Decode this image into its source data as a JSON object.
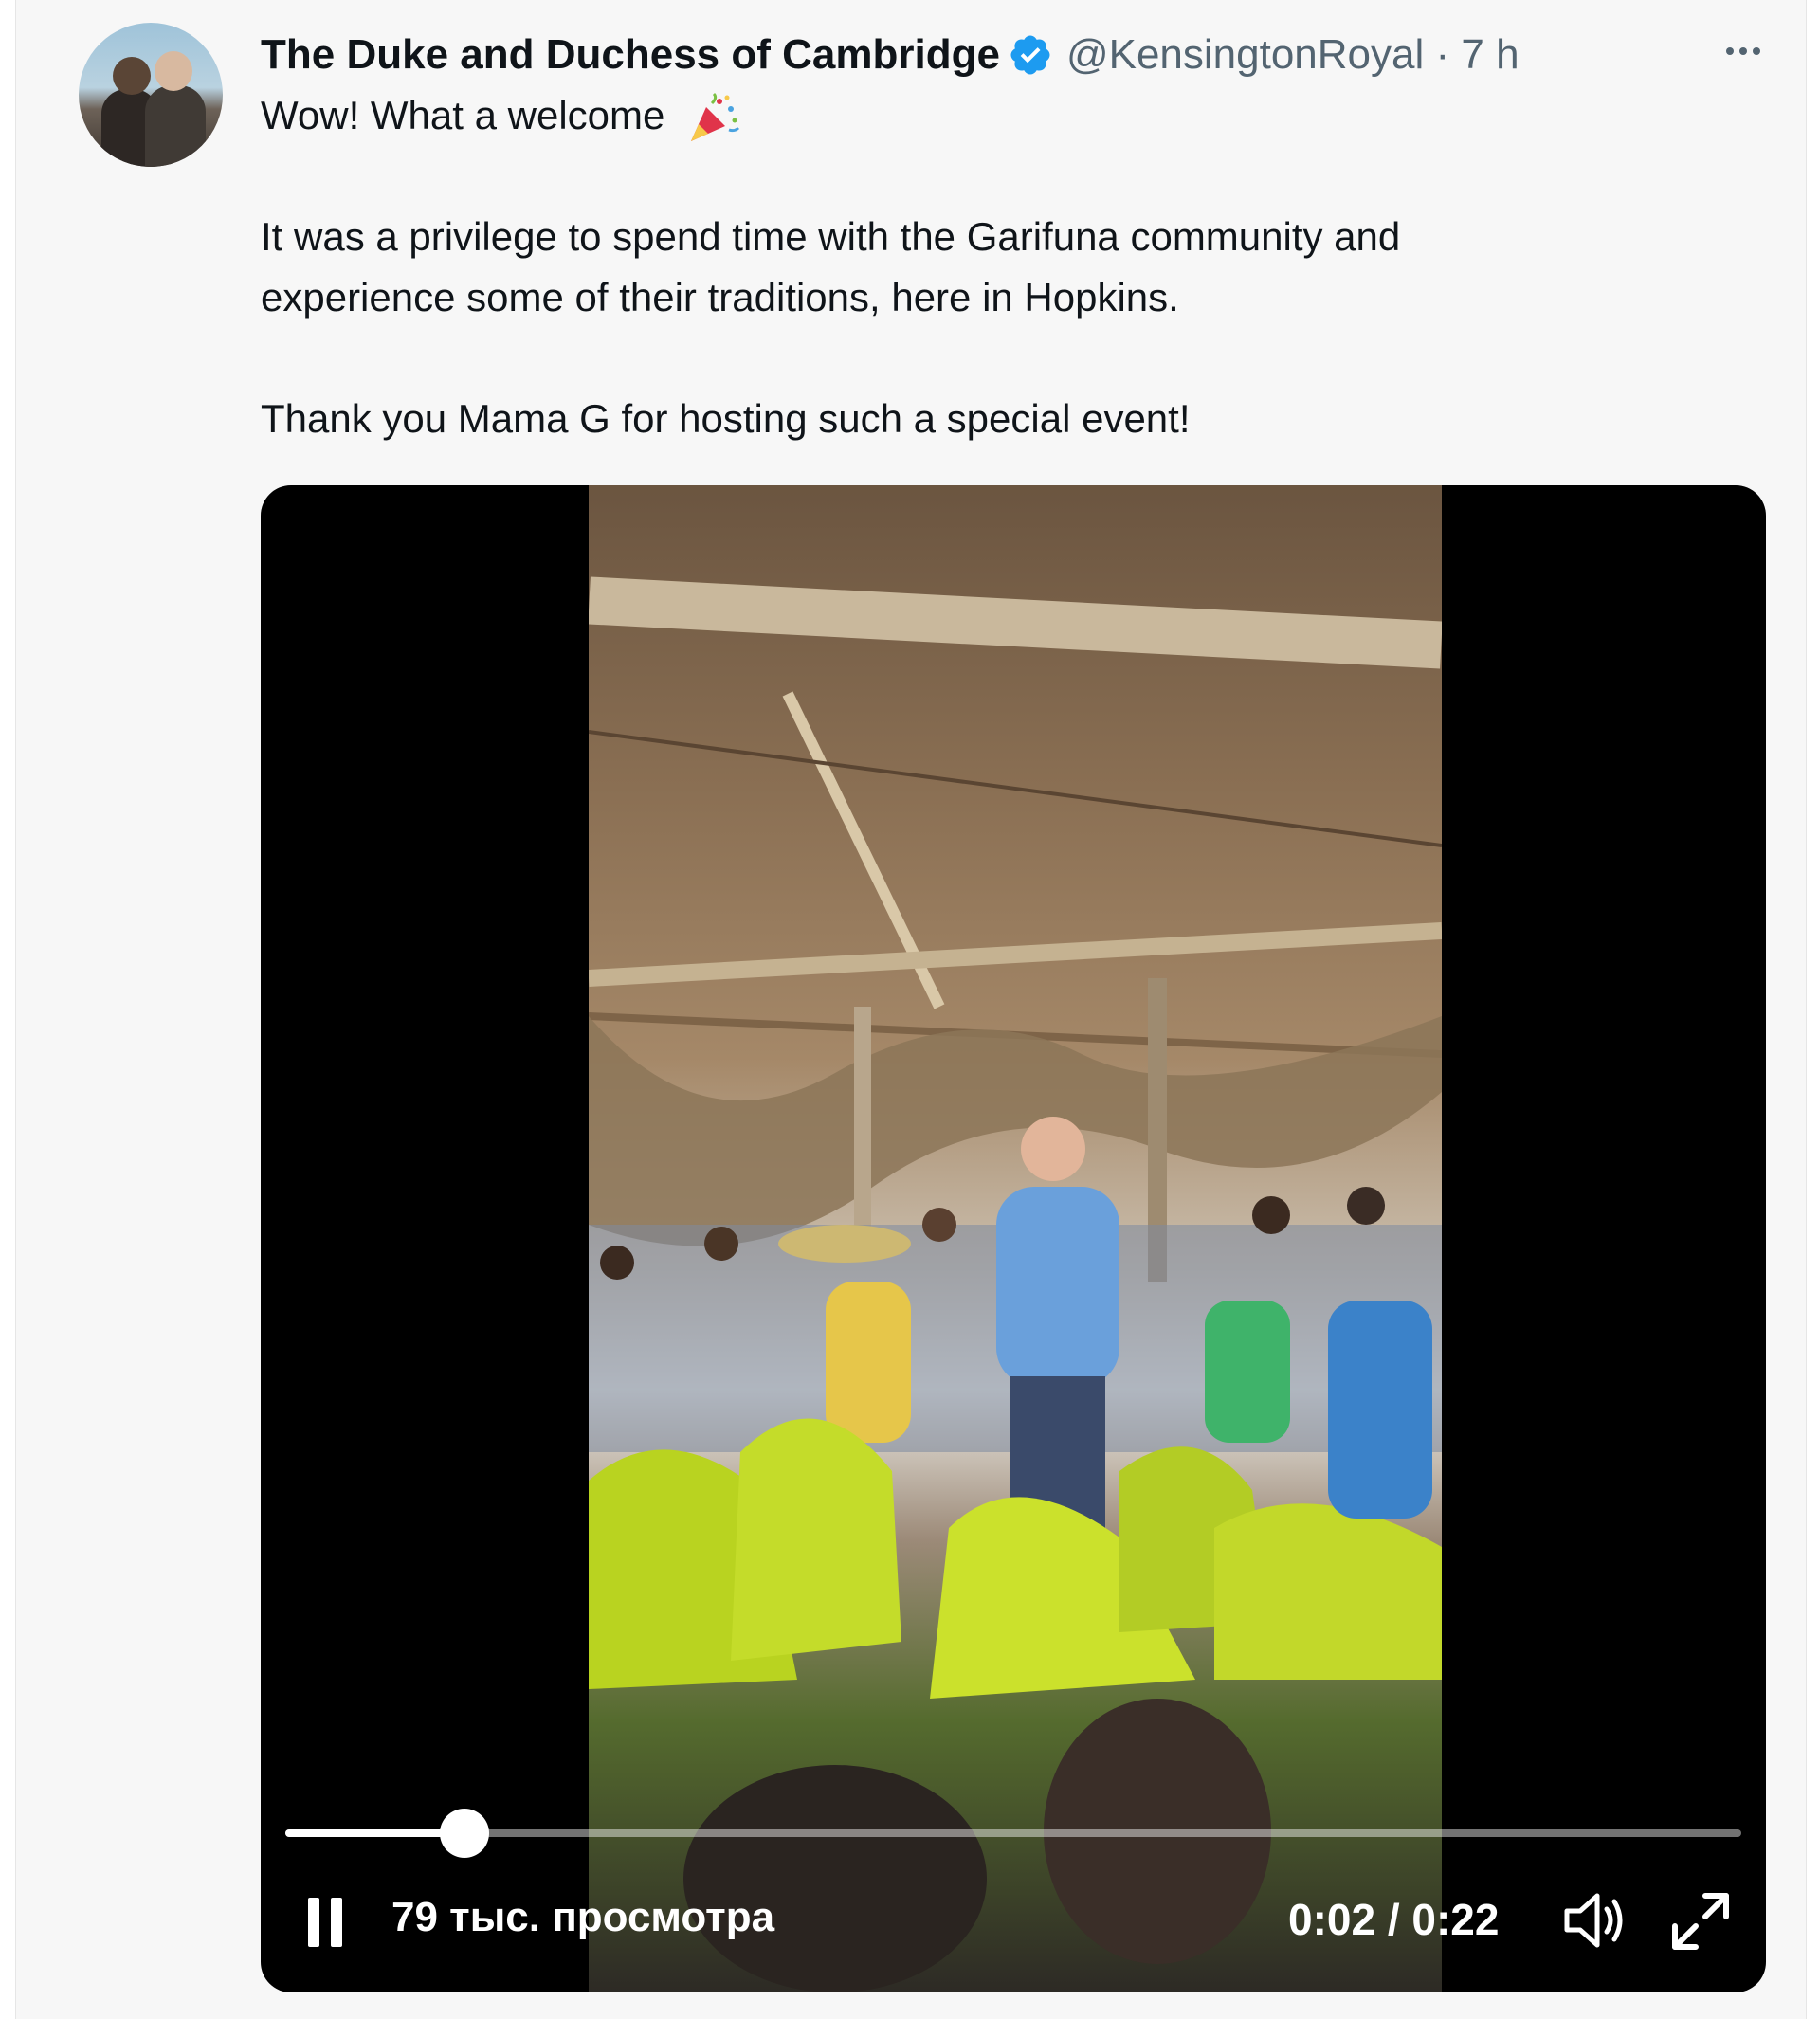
{
  "tweet": {
    "author_name": "The Duke and Duchess of Cambridge",
    "handle_time": "@KensingtonRoyal · 7 h",
    "line1": "Wow! What a welcome",
    "line2a": "It was a privilege to spend time with the Garifuna community and",
    "line2b": "experience some of their traditions, here in Hopkins.",
    "line3": "Thank you Mama G for hosting such a special event!"
  },
  "video": {
    "views": "79 тыс. просмотра",
    "time": "0:02 / 0:22",
    "progress_fraction": 0.123
  },
  "icons": {
    "verified": "verified-badge-icon",
    "party": "party-popper-icon",
    "more": "more-dots-icon",
    "pause": "pause-icon",
    "volume": "volume-icon",
    "fullscreen": "fullscreen-icon"
  },
  "colors": {
    "verified": "#1d9bf0",
    "secondary_text": "#536471",
    "background": "#f7f7f7"
  }
}
